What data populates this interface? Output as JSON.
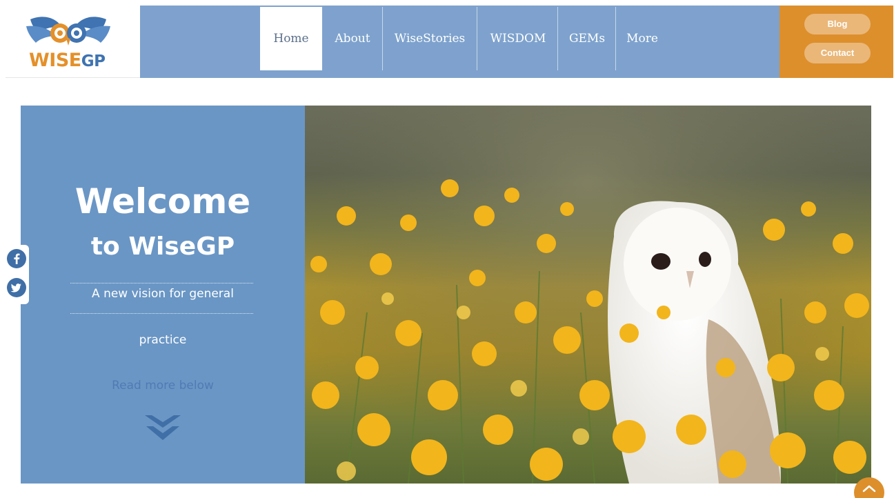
{
  "logo": {
    "wise": "WISE",
    "gp": "GP",
    "emblem_icon": "owl-wings-logo-icon"
  },
  "nav": {
    "items": [
      {
        "label": "Home",
        "active": true
      },
      {
        "label": "About"
      },
      {
        "label": "WiseStories"
      },
      {
        "label": "WISDOM"
      },
      {
        "label": "GEMs"
      },
      {
        "label": "More"
      }
    ]
  },
  "cta": {
    "blog": "Blog",
    "contact": "Contact"
  },
  "hero": {
    "title_line1": "Welcome",
    "title_line2": "to WiseGP",
    "subtitle_line1": "A new vision for general",
    "subtitle_line2": "practice",
    "read_more": "Read more below",
    "scroll_icon": "double-chevron-down-icon",
    "image_icon": "owl-in-flower-field-photo"
  },
  "social": {
    "facebook_icon": "facebook-icon",
    "twitter_icon": "twitter-icon"
  },
  "to_top_icon": "chevron-up-icon",
  "colors": {
    "nav_blue": "#7ea2cd",
    "hero_blue": "#6a96c5",
    "accent_orange": "#dd8f2c",
    "logo_blue": "#3f73b1"
  }
}
